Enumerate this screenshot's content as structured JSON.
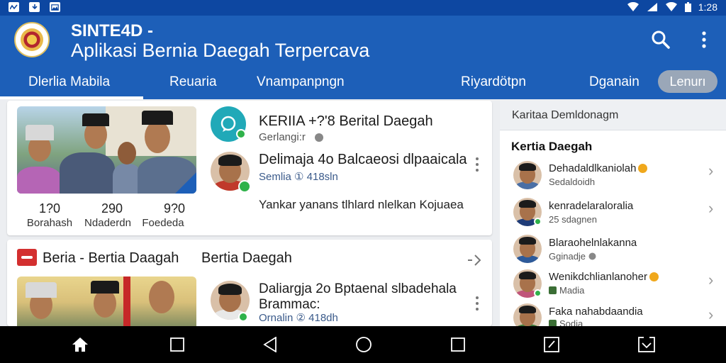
{
  "status_bar": {
    "time": "1:28"
  },
  "app": {
    "title": "SINTE4D -",
    "subtitle": "Aplikasi Bernia Daegah Terpercava"
  },
  "tabs": [
    {
      "label": "Dlerlia Mabila",
      "active": true
    },
    {
      "label": "Reuaria"
    },
    {
      "label": "Vnampanpngn"
    },
    {
      "label": "Riyardötpn"
    },
    {
      "label": "Dganain"
    },
    {
      "label": "Lenurı",
      "pill": true
    }
  ],
  "feed": {
    "card1": {
      "stats": [
        {
          "value": "1?0",
          "label": "Borahash"
        },
        {
          "value": "290",
          "label": "Ndaderdn"
        },
        {
          "value": "9?0",
          "label": "Foededa"
        }
      ],
      "post1": {
        "title": "KERIIA +?'8 Berital Daegah",
        "meta": "Gerlangi:r"
      },
      "post2": {
        "title": "Delimaja 4o Balcaeosi dlpaaicala",
        "meta": "Semlia ① 418sln"
      },
      "body": "Yankar yanans tlhlard nlelkan Kojuaea"
    },
    "card2": {
      "header_a": "Beria - Bertia Daagah",
      "header_b": "Bertia Daegah",
      "post": {
        "title": "Daliargja 2o Bptaenal slbadehala",
        "title2": "Brammac:",
        "meta": "Ornalin ② 418dh"
      }
    }
  },
  "sidebar": {
    "header": "Karitaa Demldonagm",
    "subtitle": "Kertia Daegah",
    "contacts": [
      {
        "name": "Dehadaldlkaniolah",
        "meta": "Sedaldoidh",
        "badge": "gold"
      },
      {
        "name": "kenradelaraloralia",
        "meta": "25 sdagnen"
      },
      {
        "name": "Blaraohelnlakanna",
        "meta": "Gginadje",
        "meta_icon": "globe"
      },
      {
        "name": "Wenikdchlianlanoher",
        "meta": "Madia",
        "badge": "gold",
        "meta_icon": "square"
      },
      {
        "name": "Faka nahabdaandia",
        "meta": "Sodia",
        "meta_icon": "square"
      }
    ]
  },
  "colors": {
    "status_bar": "#0d47a1",
    "app_bar": "#1d5fb8",
    "online": "#2fb24a",
    "badge": "#f0a81c"
  }
}
